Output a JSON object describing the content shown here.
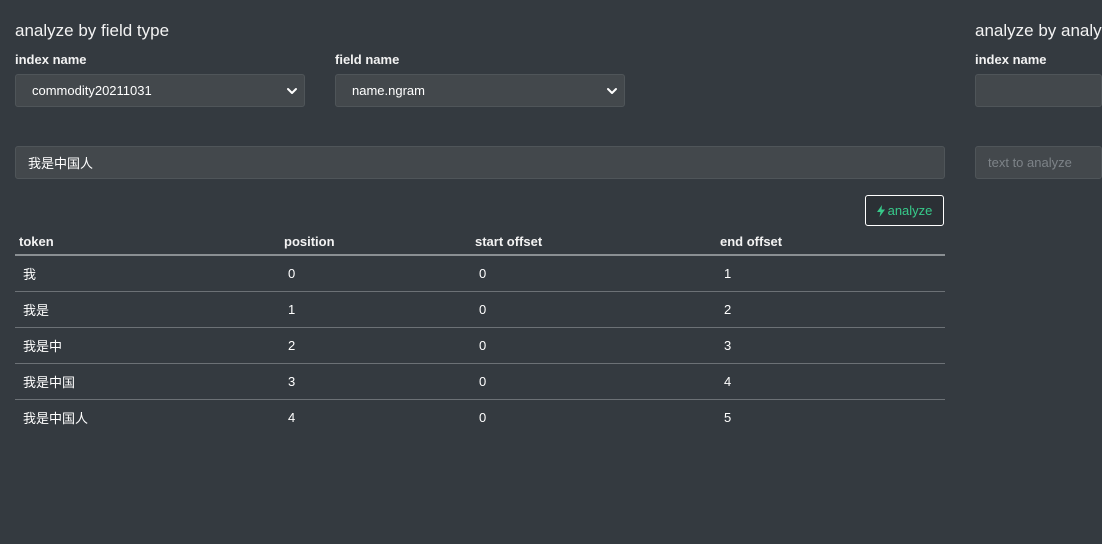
{
  "field_type_panel": {
    "title": "analyze by field type",
    "index_label": "index name",
    "index_value": "commodity20211031",
    "field_label": "field name",
    "field_value": "name.ngram",
    "text_value": "我是中国人",
    "analyze_label": "analyze",
    "table": {
      "headers": [
        "token",
        "position",
        "start offset",
        "end offset"
      ],
      "rows": [
        [
          "我",
          "0",
          "0",
          "1"
        ],
        [
          "我是",
          "1",
          "0",
          "2"
        ],
        [
          "我是中",
          "2",
          "0",
          "3"
        ],
        [
          "我是中国",
          "3",
          "0",
          "4"
        ],
        [
          "我是中国人",
          "4",
          "0",
          "5"
        ]
      ]
    }
  },
  "analyzer_panel": {
    "title": "analyze by analy",
    "index_label": "index name",
    "text_placeholder": "text to analyze"
  },
  "colors": {
    "background": "#343a40",
    "input_background": "#43484c",
    "accent": "#37c98a"
  },
  "icons": [
    "chevron-down-icon",
    "bolt-icon"
  ]
}
